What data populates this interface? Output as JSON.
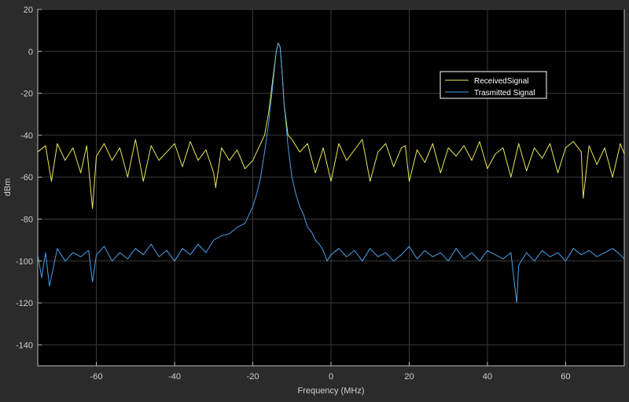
{
  "chart_data": {
    "type": "line",
    "title": "",
    "xlabel": "Frequency (MHz)",
    "ylabel": "dBm",
    "xlim": [
      -75,
      75
    ],
    "ylim": [
      -150,
      20
    ],
    "xticks": [
      -60,
      -40,
      -20,
      0,
      20,
      40,
      60
    ],
    "yticks": [
      20,
      0,
      -20,
      -40,
      -60,
      -80,
      -100,
      -120,
      -140
    ],
    "grid": true,
    "legend_position": "upper-right",
    "background": "#000000",
    "series": [
      {
        "name": "ReceivedSignal",
        "color": "#e8e85a",
        "x": [
          -75,
          -73,
          -71.5,
          -70,
          -68,
          -66,
          -64,
          -62.5,
          -61,
          -60,
          -58,
          -56,
          -54,
          -52,
          -50,
          -48,
          -46,
          -44,
          -42,
          -40,
          -38,
          -36,
          -34,
          -32,
          -30,
          -29.5,
          -28,
          -26,
          -24,
          -22,
          -20,
          -18,
          -17,
          -16,
          -15,
          -14,
          -13.5,
          -13,
          -12.5,
          -12,
          -11,
          -10,
          -8,
          -6,
          -4,
          -2,
          0,
          2,
          4,
          6,
          8,
          10,
          12,
          14,
          16,
          18,
          19,
          20,
          22,
          24,
          26,
          28,
          30,
          32,
          34,
          36,
          38,
          40,
          42,
          44,
          46,
          48,
          50,
          52,
          54,
          56,
          58,
          60,
          62,
          64,
          64.5,
          66,
          68,
          70,
          72,
          74,
          75
        ],
        "y": [
          -48,
          -45,
          -62,
          -44,
          -52,
          -46,
          -58,
          -45,
          -75,
          -50,
          -44,
          -52,
          -46,
          -60,
          -42,
          -62,
          -45,
          -52,
          -48,
          -44,
          -55,
          -43,
          -52,
          -47,
          -58,
          -65,
          -46,
          -52,
          -47,
          -56,
          -52,
          -44,
          -40,
          -30,
          -15,
          0,
          4,
          2,
          -10,
          -25,
          -40,
          -42,
          -48,
          -44,
          -58,
          -46,
          -62,
          -44,
          -52,
          -47,
          -42,
          -62,
          -48,
          -44,
          -55,
          -46,
          -45,
          -62,
          -47,
          -53,
          -44,
          -58,
          -46,
          -50,
          -45,
          -52,
          -43,
          -56,
          -49,
          -46,
          -60,
          -44,
          -57,
          -46,
          -51,
          -44,
          -58,
          -46,
          -43,
          -48,
          -70,
          -45,
          -54,
          -46,
          -60,
          -44,
          -49
        ]
      },
      {
        "name": "Trasmitted Signal",
        "color": "#4a9fe8",
        "x": [
          -75,
          -74,
          -73,
          -72,
          -70,
          -68,
          -66,
          -64,
          -62,
          -61,
          -60,
          -58,
          -56,
          -54,
          -52,
          -50,
          -48,
          -46,
          -44,
          -42,
          -40,
          -38,
          -36,
          -34,
          -32,
          -30,
          -28,
          -26,
          -24,
          -22,
          -21,
          -20,
          -19,
          -18,
          -17,
          -16,
          -15,
          -14,
          -13.5,
          -13,
          -12.5,
          -12,
          -11,
          -10,
          -9,
          -8,
          -7,
          -6,
          -5,
          -4,
          -3,
          -2,
          -1,
          0,
          2,
          4,
          6,
          8,
          10,
          12,
          14,
          16,
          18,
          20,
          22,
          24,
          26,
          28,
          30,
          32,
          34,
          36,
          38,
          40,
          42,
          44,
          46,
          47.5,
          48,
          50,
          52,
          54,
          56,
          58,
          60,
          62,
          64,
          66,
          68,
          70,
          72,
          74,
          75
        ],
        "y": [
          -97,
          -108,
          -96,
          -112,
          -94,
          -100,
          -96,
          -98,
          -95,
          -110,
          -97,
          -93,
          -100,
          -96,
          -99,
          -94,
          -97,
          -92,
          -98,
          -95,
          -100,
          -94,
          -97,
          -92,
          -96,
          -90,
          -88,
          -87,
          -84,
          -82,
          -78,
          -74,
          -68,
          -60,
          -48,
          -35,
          -18,
          0,
          4,
          2,
          -10,
          -25,
          -45,
          -60,
          -68,
          -74,
          -78,
          -84,
          -86,
          -90,
          -92,
          -95,
          -100,
          -97,
          -94,
          -98,
          -95,
          -100,
          -94,
          -98,
          -96,
          -100,
          -97,
          -93,
          -99,
          -95,
          -98,
          -96,
          -100,
          -94,
          -99,
          -96,
          -100,
          -95,
          -97,
          -99,
          -96,
          -120,
          -102,
          -96,
          -100,
          -95,
          -98,
          -96,
          -100,
          -94,
          -97,
          -95,
          -98,
          -96,
          -94,
          -97,
          -99
        ]
      }
    ]
  }
}
